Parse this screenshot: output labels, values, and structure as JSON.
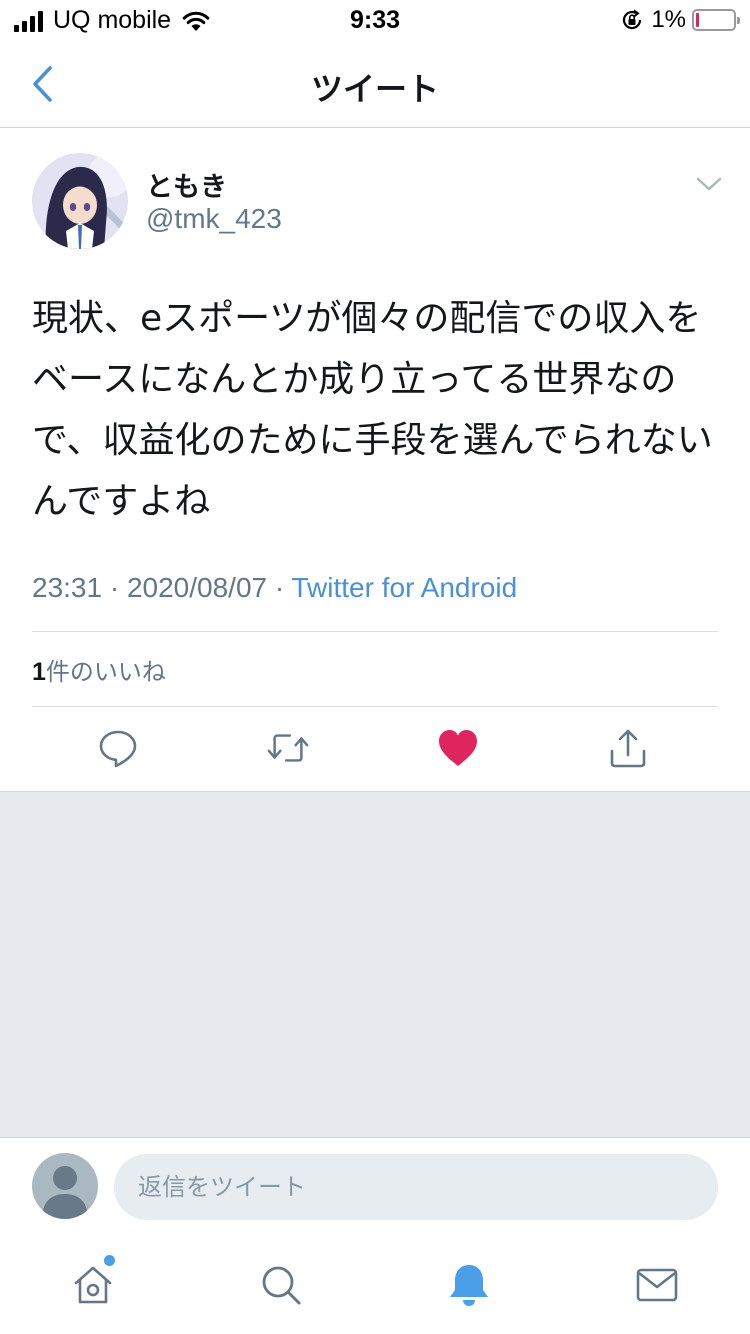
{
  "status_bar": {
    "carrier": "UQ mobile",
    "time": "9:33",
    "battery": "1%",
    "battery_level": 0.01
  },
  "header": {
    "title": "ツイート"
  },
  "tweet": {
    "author_name": "ともき",
    "author_handle": "@tmk_423",
    "text": "現状、eスポーツが個々の配信での収入をベースになんとか成り立ってる世界なので、収益化のために手段を選んでられないんですよね",
    "time": "23:31",
    "separator": "·",
    "date": "2020/08/07",
    "source": "Twitter for Android",
    "likes_count": "1",
    "likes_label": "件のいいね",
    "liked": true
  },
  "reply": {
    "placeholder": "返信をツイート"
  },
  "colors": {
    "accent": "#4a90d9",
    "like": "#e0245e",
    "secondary_text": "#657786",
    "background_gray": "#e6e9ed"
  },
  "icons": {
    "back": "chevron-left-icon",
    "menu": "chevron-down-icon",
    "reply": "comment-icon",
    "retweet": "retweet-icon",
    "like": "heart-icon",
    "share": "share-icon",
    "home": "home-icon",
    "search": "search-icon",
    "notifications": "bell-icon",
    "messages": "mail-icon"
  },
  "tabs": [
    "home",
    "search",
    "notifications",
    "messages"
  ],
  "active_tab": "notifications"
}
